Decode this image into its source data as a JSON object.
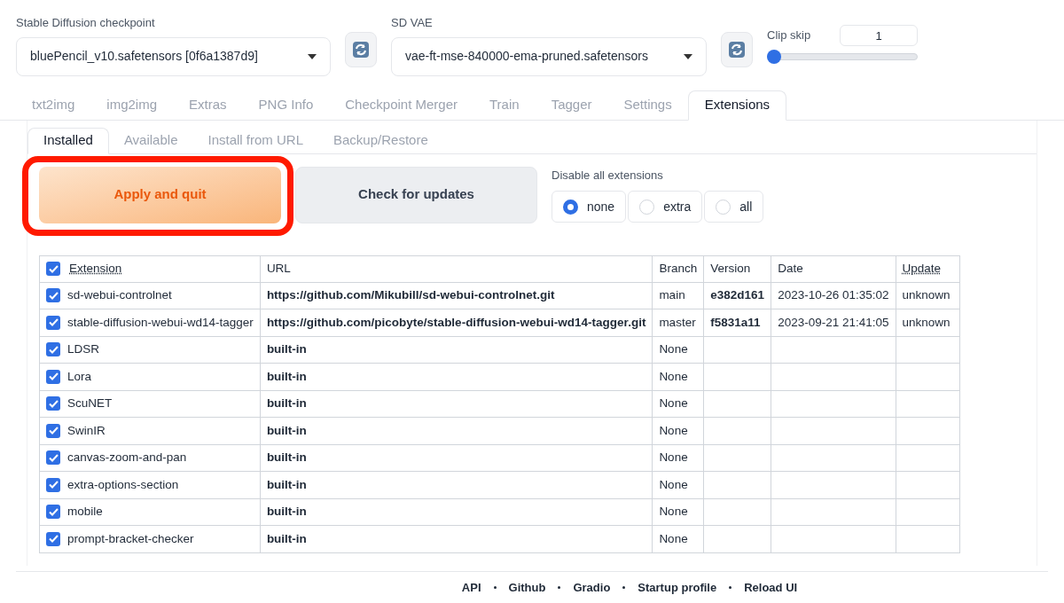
{
  "checkpoint": {
    "label": "Stable Diffusion checkpoint",
    "value": "bluePencil_v10.safetensors [0f6a1387d9]"
  },
  "vae": {
    "label": "SD VAE",
    "value": "vae-ft-mse-840000-ema-pruned.safetensors"
  },
  "clip_skip": {
    "label": "Clip skip",
    "value": "1",
    "level": 0
  },
  "tabs": [
    {
      "label": "txt2img",
      "selected": false
    },
    {
      "label": "img2img",
      "selected": false
    },
    {
      "label": "Extras",
      "selected": false
    },
    {
      "label": "PNG Info",
      "selected": false
    },
    {
      "label": "Checkpoint Merger",
      "selected": false
    },
    {
      "label": "Train",
      "selected": false
    },
    {
      "label": "Tagger",
      "selected": false
    },
    {
      "label": "Settings",
      "selected": false
    },
    {
      "label": "Extensions",
      "selected": true
    }
  ],
  "subtabs": [
    {
      "label": "Installed",
      "selected": true
    },
    {
      "label": "Available",
      "selected": false
    },
    {
      "label": "Install from URL",
      "selected": false
    },
    {
      "label": "Backup/Restore",
      "selected": false
    }
  ],
  "apply_button": {
    "label": "Apply and quit",
    "highlighted": true
  },
  "check_button": {
    "label": "Check for updates"
  },
  "disable_all": {
    "label": "Disable all extensions",
    "options": [
      {
        "label": "none",
        "selected": true
      },
      {
        "label": "extra",
        "selected": false
      },
      {
        "label": "all",
        "selected": false
      }
    ]
  },
  "table": {
    "all_checked": true,
    "columns": [
      {
        "label": "Extension",
        "dotted": true
      },
      {
        "label": "URL",
        "dotted": false
      },
      {
        "label": "Branch",
        "dotted": false
      },
      {
        "label": "Version",
        "dotted": false
      },
      {
        "label": "Date",
        "dotted": false
      },
      {
        "label": "Update",
        "dotted": true
      }
    ],
    "rows": [
      {
        "name": "sd-webui-controlnet",
        "checked": true,
        "url": "https://github.com/Mikubill/sd-webui-controlnet.git",
        "branch": "main",
        "version": "e382d161",
        "date": "2023-10-26 01:35:02",
        "update": "unknown"
      },
      {
        "name": "stable-diffusion-webui-wd14-tagger",
        "checked": true,
        "url": "https://github.com/picobyte/stable-diffusion-webui-wd14-tagger.git",
        "branch": "master",
        "version": "f5831a11",
        "date": "2023-09-21 21:41:05",
        "update": "unknown"
      },
      {
        "name": "LDSR",
        "checked": true,
        "url": "built-in",
        "branch": "None"
      },
      {
        "name": "Lora",
        "checked": true,
        "url": "built-in",
        "branch": "None"
      },
      {
        "name": "ScuNET",
        "checked": true,
        "url": "built-in",
        "branch": "None"
      },
      {
        "name": "SwinIR",
        "checked": true,
        "url": "built-in",
        "branch": "None"
      },
      {
        "name": "canvas-zoom-and-pan",
        "checked": true,
        "url": "built-in",
        "branch": "None"
      },
      {
        "name": "extra-options-section",
        "checked": true,
        "url": "built-in",
        "branch": "None"
      },
      {
        "name": "mobile",
        "checked": true,
        "url": "built-in",
        "branch": "None"
      },
      {
        "name": "prompt-bracket-checker",
        "checked": true,
        "url": "built-in",
        "branch": "None"
      }
    ]
  },
  "footer_links": [
    "API",
    "Github",
    "Gradio",
    "Startup profile",
    "Reload UI"
  ]
}
